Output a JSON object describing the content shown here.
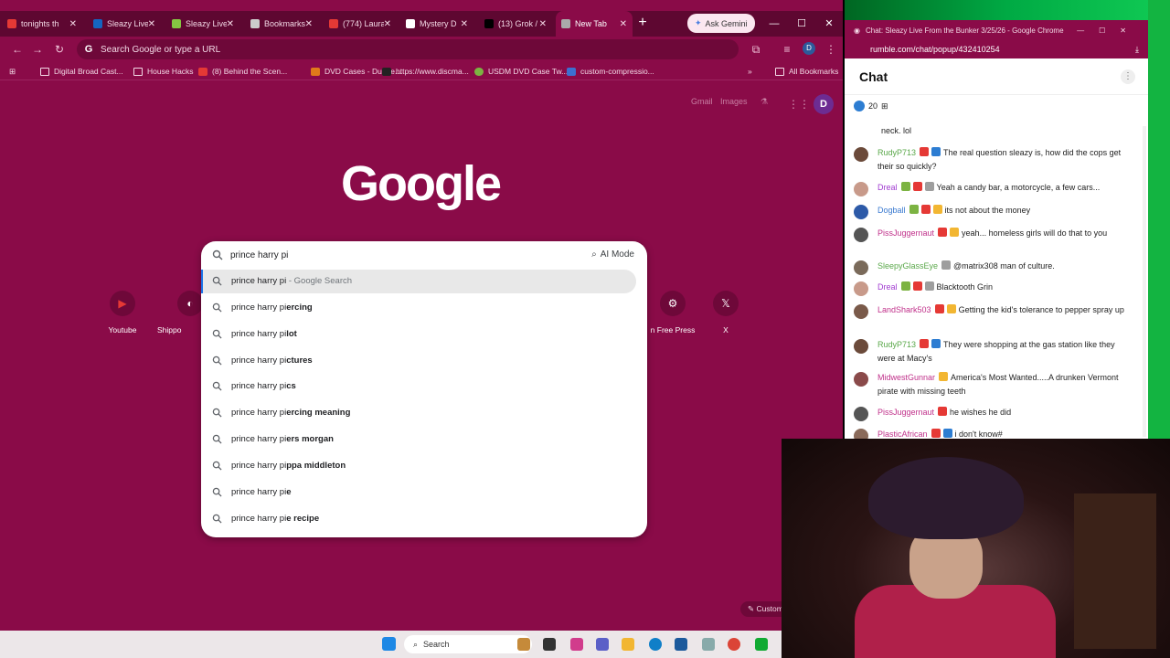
{
  "browser": {
    "tabs": [
      {
        "label": "tonights th",
        "favicon_color": "#e53935"
      },
      {
        "label": "Sleazy Live",
        "favicon_color": "#1565c0"
      },
      {
        "label": "Sleazy Live",
        "favicon_color": "#85c742"
      },
      {
        "label": "Bookmarks",
        "favicon_color": "#cccccc"
      },
      {
        "label": "(774) Laura",
        "favicon_color": "#e53935"
      },
      {
        "label": "Mystery D",
        "favicon_color": "#ffffff"
      },
      {
        "label": "(13) Grok /",
        "favicon_color": "#000000"
      },
      {
        "label": "New Tab",
        "favicon_color": "#aaaaaa"
      }
    ],
    "ask_gemini": "Ask Gemini",
    "omnibox_placeholder": "Search Google or type a URL",
    "profile_initial": "D",
    "bookmarks": [
      {
        "label": "Digital Broad Cast...",
        "icon": "folder-icon"
      },
      {
        "label": "House Hacks",
        "icon": "folder-icon"
      },
      {
        "label": "(8) Behind the Scen...",
        "icon": "youtube-icon"
      },
      {
        "label": "DVD Cases - Duode...",
        "icon": "dvd-icon"
      },
      {
        "label": "https://www.discma...",
        "icon": "site-icon"
      },
      {
        "label": "USDM DVD Case Tw...",
        "icon": "site-icon"
      },
      {
        "label": "custom-compressio...",
        "icon": "site-icon"
      }
    ],
    "all_bookmarks": "All Bookmarks"
  },
  "ntp": {
    "top_links": [
      "Gmail",
      "Images"
    ],
    "logo": "Google",
    "search_query": "prince harry pi",
    "ai_mode": "AI Mode",
    "suggestions": [
      {
        "prefix": "prince harry pi",
        "bold": "",
        "suffix": " - Google Search"
      },
      {
        "prefix": "prince harry pi",
        "bold": "ercing",
        "suffix": ""
      },
      {
        "prefix": "prince harry pi",
        "bold": "lot",
        "suffix": ""
      },
      {
        "prefix": "prince harry pi",
        "bold": "ctures",
        "suffix": ""
      },
      {
        "prefix": "prince harry pi",
        "bold": "cs",
        "suffix": ""
      },
      {
        "prefix": "prince harry pi",
        "bold": "ercing meaning",
        "suffix": ""
      },
      {
        "prefix": "prince harry pi",
        "bold": "ers morgan",
        "suffix": ""
      },
      {
        "prefix": "prince harry pi",
        "bold": "ppa middleton",
        "suffix": ""
      },
      {
        "prefix": "prince harry pi",
        "bold": "e",
        "suffix": ""
      },
      {
        "prefix": "prince harry pi",
        "bold": "e recipe",
        "suffix": ""
      }
    ],
    "shortcuts": [
      {
        "label": "Youtube",
        "icon": "youtube-icon"
      },
      {
        "label": "Shippo",
        "icon": "shippo-icon"
      },
      {
        "label": "n Free Press",
        "icon": "free-press-icon"
      },
      {
        "label": "X",
        "icon": "x-icon"
      }
    ],
    "customize": "Custom"
  },
  "taskbar": {
    "search": "Search"
  },
  "chat_window": {
    "title": "Chat: Sleazy Live From the Bunker 3/25/26 - Google Chrome",
    "url": "rumble.com/chat/popup/432410254",
    "header": "Chat",
    "viewer_count": "20",
    "messages": [
      {
        "user": "",
        "text": "neck. lol",
        "user_color": "#222222",
        "avatar_color": "#cccccc"
      },
      {
        "user": "RudyP713",
        "text": "The real question sleazy is, how did the cops get their so quickly?",
        "user_color": "#5aa84a",
        "avatar_color": "#6b4a3a"
      },
      {
        "user": "Dreal",
        "text": "Yeah a candy bar, a motorcycle, a few cars...",
        "user_color": "#a03ad0",
        "avatar_color": "#c89a8a"
      },
      {
        "user": "Dogball",
        "text": "its not about the money",
        "user_color": "#3a7ad0",
        "avatar_color": "#2d5aa8"
      },
      {
        "user": "PissJuggernaut",
        "text": "yeah... homeless girls will do that to you",
        "user_color": "#c0308a",
        "avatar_color": "#555555"
      },
      {
        "user": "SleepyGlassEye",
        "text": "@matrix308 man of culture.",
        "user_color": "#5aa84a",
        "avatar_color": "#7a6a5a"
      },
      {
        "user": "Dreal",
        "text": "Blacktooth Grin",
        "user_color": "#a03ad0",
        "avatar_color": "#c89a8a"
      },
      {
        "user": "LandShark503",
        "text": "Getting the kid's tolerance to pepper spray up",
        "user_color": "#c0308a",
        "avatar_color": "#7a5a4a"
      },
      {
        "user": "RudyP713",
        "text": "They were shopping at the gas station like they were at Macy's",
        "user_color": "#5aa84a",
        "avatar_color": "#6b4a3a"
      },
      {
        "user": "MidwestGunnar",
        "text": "America's Most Wanted.....A drunken Vermont pirate with missing teeth",
        "user_color": "#c0308a",
        "avatar_color": "#8a4a4a"
      },
      {
        "user": "PissJuggernaut",
        "text": "he wishes he did",
        "user_color": "#c0308a",
        "avatar_color": "#555555"
      },
      {
        "user": "PlasticAfrican",
        "text": "i don't know#",
        "user_color": "#c0308a",
        "avatar_color": "#8a6a5a"
      }
    ]
  },
  "colors": {
    "chrome_bg": "#8a0b48",
    "tab_strip": "#5e0731",
    "accent": "#1a73e8"
  }
}
